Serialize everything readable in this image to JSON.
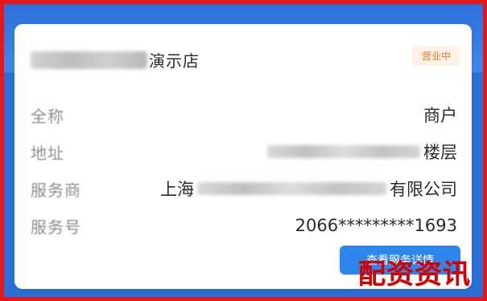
{
  "card": {
    "title_suffix": "演示店",
    "badge": "营业中",
    "rows": [
      {
        "label": "全称",
        "value": "商户"
      },
      {
        "label": "地址",
        "value_suffix": "楼层"
      },
      {
        "label": "服务商",
        "value_prefix": "上海",
        "value_suffix": "有限公司"
      },
      {
        "label": "服务号",
        "value": "2066*********1693"
      }
    ],
    "action_button": "查看服务详情"
  },
  "watermark": "配资资讯",
  "colors": {
    "border": "#e7161a",
    "top": "#2b6fd8",
    "button": "#2f86ea",
    "badge_text": "#e97923"
  }
}
